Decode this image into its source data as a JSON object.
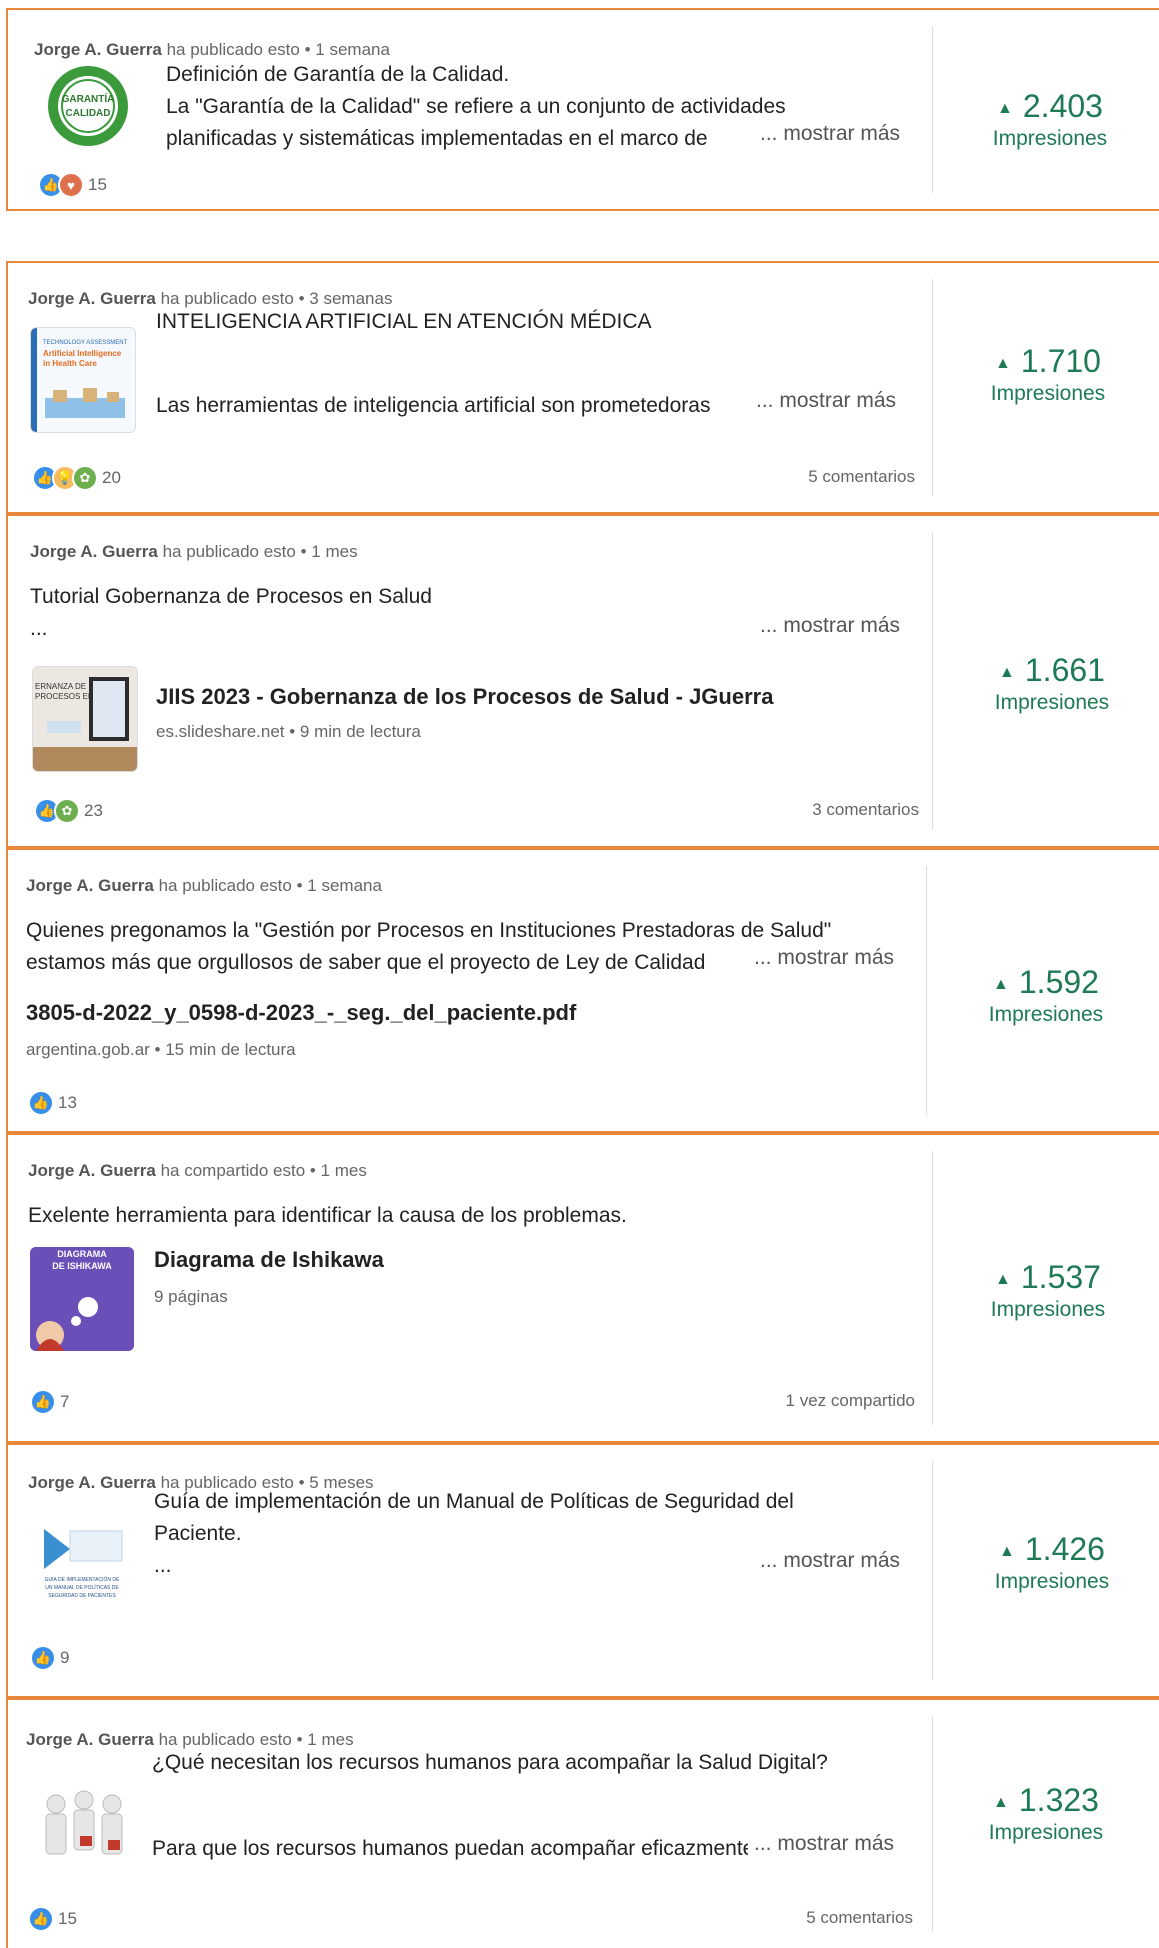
{
  "impressions_label": "Impresiones",
  "more_label": "... mostrar más",
  "posts": [
    {
      "author": "Jorge A. Guerra",
      "action": "ha publicado esto",
      "time": "1 semana",
      "lines": [
        "Definición de Garantía de la Calidad.",
        "La \"Garantía de la Calidad\" se refiere a un conjunto de actividades",
        "planificadas y sistemáticas implementadas en el marco de"
      ],
      "thumb_text": "GARANTÍA DE CALIDAD",
      "reactions": [
        "like-icon",
        "love-icon"
      ],
      "reaction_count": "15",
      "comments": "",
      "impressions": "2.403"
    },
    {
      "author": "Jorge A. Guerra",
      "action": "ha publicado esto",
      "time": "3 semanas",
      "lines": [
        "INTELIGENCIA ARTIFICIAL EN ATENCIÓN MÉDICA",
        "",
        "Las herramientas de inteligencia artificial son prometedoras"
      ],
      "thumb_text": "Artificial Intelligence in Health Care",
      "reactions": [
        "like-icon",
        "insightful-icon",
        "support-icon"
      ],
      "reaction_count": "20",
      "comments": "5 comentarios",
      "impressions": "1.710"
    },
    {
      "author": "Jorge A. Guerra",
      "action": "ha publicado esto",
      "time": "1 mes",
      "lines": [
        "Tutorial Gobernanza de Procesos en Salud",
        "..."
      ],
      "link_title": "JIIS 2023 - Gobernanza de los Procesos de Salud - JGuerra",
      "link_sub": "es.slideshare.net • 9 min de lectura",
      "thumb_text": "ERNANZA DE PROCESOS EN",
      "reactions": [
        "like-icon",
        "support-icon"
      ],
      "reaction_count": "23",
      "comments": "3 comentarios",
      "impressions": "1.661"
    },
    {
      "author": "Jorge A. Guerra",
      "action": "ha publicado esto",
      "time": "1 semana",
      "lines": [
        "Quienes pregonamos la \"Gestión por Procesos en Instituciones Prestadoras de Salud\"",
        "estamos más que orgullosos de saber que el proyecto de Ley de Calidad"
      ],
      "link_title": "3805-d-2022_y_0598-d-2023_-_seg._del_paciente.pdf",
      "link_sub": "argentina.gob.ar • 15 min de lectura",
      "reactions": [
        "like-icon"
      ],
      "reaction_count": "13",
      "comments": "",
      "impressions": "1.592"
    },
    {
      "author": "Jorge A. Guerra",
      "action": "ha compartido esto",
      "time": "1 mes",
      "lines": [
        "Exelente herramienta para identificar la causa de los problemas."
      ],
      "link_title": "Diagrama de Ishikawa",
      "link_sub": "9 páginas",
      "thumb_text": "DIAGRAMA DE ISHIKAWA",
      "reactions": [
        "like-icon"
      ],
      "reaction_count": "7",
      "comments": "1 vez compartido",
      "impressions": "1.537"
    },
    {
      "author": "Jorge A. Guerra",
      "action": "ha publicado esto",
      "time": "5 meses",
      "lines": [
        "Guía de implementación de un Manual de Políticas de Seguridad del",
        "Paciente.",
        "..."
      ],
      "thumb_text": "GUÍA DE IMPLEMENTACIÓN DE UN MANUAL DE POLÍTICAS DE SEGURIDAD DE PACIENTES",
      "reactions": [
        "like-icon"
      ],
      "reaction_count": "9",
      "comments": "",
      "impressions": "1.426"
    },
    {
      "author": "Jorge A. Guerra",
      "action": "ha publicado esto",
      "time": "1 mes",
      "lines": [
        "¿Qué necesitan los recursos humanos para acompañar la Salud Digital?",
        "",
        "Para que los recursos humanos puedan acompañar eficazmente"
      ],
      "reactions": [
        "like-icon"
      ],
      "reaction_count": "15",
      "comments": "5 comentarios",
      "impressions": "1.323"
    }
  ],
  "colors": {
    "accent_border": "#e8863c",
    "impressions_green": "#1e7a54",
    "like_blue": "#378fe9",
    "love_red": "#df704d",
    "support_green": "#6dae4f",
    "insightful_gold": "#f5bb5c"
  }
}
